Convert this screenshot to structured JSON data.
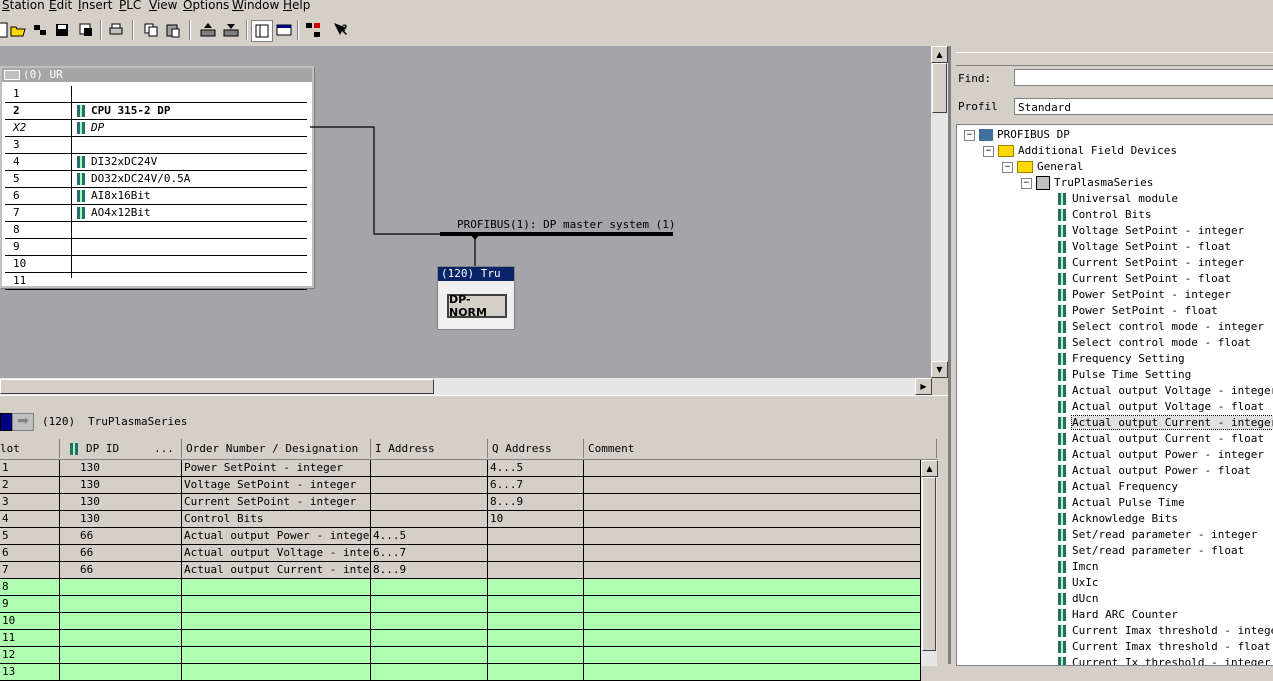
{
  "menu": [
    "Station",
    "Edit",
    "Insert",
    "PLC",
    "View",
    "Options",
    "Window",
    "Help"
  ],
  "toolbar": {
    "icons": [
      "new-icon",
      "open-icon",
      "download-icon",
      "save-icon",
      "compile-icon",
      "print-icon",
      "copy-icon",
      "paste-icon",
      "upload-icon",
      "download-module-icon",
      "catalog-icon",
      "window-icon",
      "network-icon",
      "help-icon"
    ]
  },
  "rack": {
    "title": "(0) UR",
    "rows": [
      {
        "slot": "1",
        "module": ""
      },
      {
        "slot": "2",
        "module": "CPU 315-2 DP"
      },
      {
        "slot": "X2",
        "module": "DP"
      },
      {
        "slot": "3",
        "module": ""
      },
      {
        "slot": "4",
        "module": "DI32xDC24V"
      },
      {
        "slot": "5",
        "module": "DO32xDC24V/0.5A"
      },
      {
        "slot": "6",
        "module": "AI8x16Bit"
      },
      {
        "slot": "7",
        "module": "AO4x12Bit"
      },
      {
        "slot": "8",
        "module": ""
      },
      {
        "slot": "9",
        "module": ""
      },
      {
        "slot": "10",
        "module": ""
      },
      {
        "slot": "11",
        "module": ""
      }
    ]
  },
  "bus": {
    "label": "PROFIBUS(1): DP master system (1)"
  },
  "dp_node": {
    "header": "(120) Tru",
    "button": "DP-NORM"
  },
  "detail": {
    "address": "(120)",
    "name": "TruPlasmaSeries",
    "columns": [
      "lot",
      "DP ID",
      "...",
      "Order Number / Designation",
      "I Address",
      "Q Address",
      "Comment"
    ],
    "rows": [
      {
        "slot": "1",
        "dpid": "130",
        "order": "Power SetPoint - integer",
        "iaddr": "",
        "qaddr": "4...5",
        "comment": ""
      },
      {
        "slot": "2",
        "dpid": "130",
        "order": "Voltage SetPoint - integer",
        "iaddr": "",
        "qaddr": "6...7",
        "comment": ""
      },
      {
        "slot": "3",
        "dpid": "130",
        "order": "Current SetPoint - integer",
        "iaddr": "",
        "qaddr": "8...9",
        "comment": ""
      },
      {
        "slot": "4",
        "dpid": "130",
        "order": "Control Bits",
        "iaddr": "",
        "qaddr": "10",
        "comment": ""
      },
      {
        "slot": "5",
        "dpid": "66",
        "order": "Actual output Power - integer",
        "iaddr": "4...5",
        "qaddr": "",
        "comment": ""
      },
      {
        "slot": "6",
        "dpid": "66",
        "order": "Actual output Voltage - integer",
        "iaddr": "6...7",
        "qaddr": "",
        "comment": ""
      },
      {
        "slot": "7",
        "dpid": "66",
        "order": "Actual output Current - integer",
        "iaddr": "8...9",
        "qaddr": "",
        "comment": ""
      },
      {
        "slot": "8",
        "dpid": "",
        "order": "",
        "iaddr": "",
        "qaddr": "",
        "comment": ""
      },
      {
        "slot": "9",
        "dpid": "",
        "order": "",
        "iaddr": "",
        "qaddr": "",
        "comment": ""
      },
      {
        "slot": "10",
        "dpid": "",
        "order": "",
        "iaddr": "",
        "qaddr": "",
        "comment": ""
      },
      {
        "slot": "11",
        "dpid": "",
        "order": "",
        "iaddr": "",
        "qaddr": "",
        "comment": ""
      },
      {
        "slot": "12",
        "dpid": "",
        "order": "",
        "iaddr": "",
        "qaddr": "",
        "comment": ""
      },
      {
        "slot": "13",
        "dpid": "",
        "order": "",
        "iaddr": "",
        "qaddr": "",
        "comment": ""
      }
    ]
  },
  "catalog": {
    "find_label": "Find:",
    "find_value": "",
    "profil_label": "Profil",
    "profil_value": "Standard",
    "tree": {
      "root": "PROFIBUS DP",
      "additional": "Additional Field Devices",
      "general": "General",
      "series": "TruPlasmaSeries",
      "items": [
        "Universal module",
        "Control Bits",
        "Voltage SetPoint - integer",
        "Voltage SetPoint - float",
        "Current SetPoint - integer",
        "Current SetPoint - float",
        "Power SetPoint - integer",
        "Power SetPoint - float",
        "Select control mode - integer",
        "Select control mode - float",
        "Frequency Setting",
        "Pulse Time Setting",
        "Actual output Voltage - integer",
        "Actual output Voltage - float",
        "Actual output Current - integer",
        "Actual output Current - float",
        "Actual output Power - integer",
        "Actual output Power - float",
        "Actual Frequency",
        "Actual Pulse Time",
        "Acknowledge Bits",
        "Set/read parameter - integer",
        "Set/read parameter - float",
        "Imcn",
        "UxIc",
        "dUcn",
        "Hard ARC Counter",
        "Current Imax threshold - integer",
        "Current Imax threshold - float",
        "Current Ix threshold - integer"
      ],
      "selected_index": 14
    }
  }
}
